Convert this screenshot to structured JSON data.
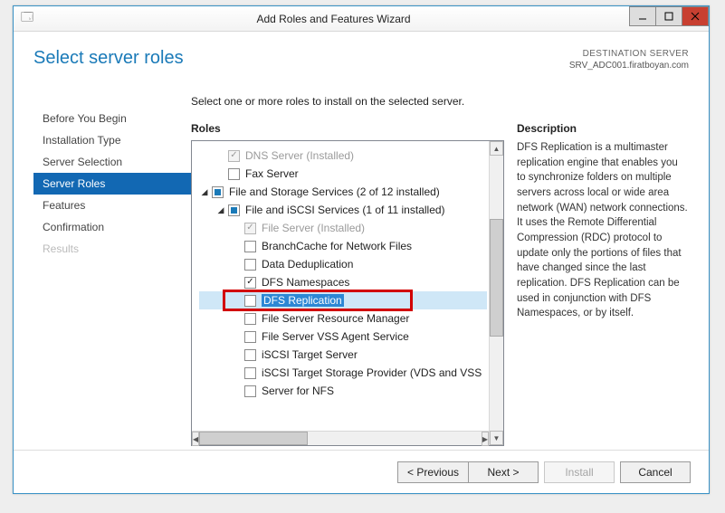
{
  "window": {
    "title": "Add Roles and Features Wizard"
  },
  "header": {
    "title": "Select server roles",
    "destination_label": "DESTINATION SERVER",
    "destination_server": "SRV_ADC001.firatboyan.com"
  },
  "nav": {
    "items": [
      "Before You Begin",
      "Installation Type",
      "Server Selection",
      "Server Roles",
      "Features",
      "Confirmation",
      "Results"
    ],
    "active_index": 3
  },
  "main": {
    "instructions": "Select one or more roles to install on the selected server.",
    "roles_label": "Roles",
    "description_label": "Description",
    "description_text": "DFS Replication is a multimaster replication engine that enables you to synchronize folders on multiple servers across local or wide area network (WAN) network connections. It uses the Remote Differential Compression (RDC) protocol to update only the portions of files that have changed since the last replication. DFS Replication can be used in conjunction with DFS Namespaces, or by itself.",
    "roles": [
      {
        "indent": 1,
        "twisty": "",
        "check": "chk",
        "disabled": true,
        "label": "DNS Server (Installed)",
        "selected": false
      },
      {
        "indent": 1,
        "twisty": "",
        "check": "off",
        "disabled": false,
        "label": "Fax Server",
        "selected": false
      },
      {
        "indent": 0,
        "twisty": "open",
        "check": "tri",
        "disabled": false,
        "label": "File and Storage Services (2 of 12 installed)",
        "selected": false
      },
      {
        "indent": 1,
        "twisty": "open",
        "check": "tri",
        "disabled": false,
        "label": "File and iSCSI Services (1 of 11 installed)",
        "selected": false
      },
      {
        "indent": 2,
        "twisty": "",
        "check": "chk",
        "disabled": true,
        "label": "File Server (Installed)",
        "selected": false
      },
      {
        "indent": 2,
        "twisty": "",
        "check": "off",
        "disabled": false,
        "label": "BranchCache for Network Files",
        "selected": false
      },
      {
        "indent": 2,
        "twisty": "",
        "check": "off",
        "disabled": false,
        "label": "Data Deduplication",
        "selected": false
      },
      {
        "indent": 2,
        "twisty": "",
        "check": "chk",
        "disabled": false,
        "label": "DFS Namespaces",
        "selected": false
      },
      {
        "indent": 2,
        "twisty": "",
        "check": "off",
        "disabled": false,
        "label": "DFS Replication",
        "selected": true
      },
      {
        "indent": 2,
        "twisty": "",
        "check": "off",
        "disabled": false,
        "label": "File Server Resource Manager",
        "selected": false
      },
      {
        "indent": 2,
        "twisty": "",
        "check": "off",
        "disabled": false,
        "label": "File Server VSS Agent Service",
        "selected": false
      },
      {
        "indent": 2,
        "twisty": "",
        "check": "off",
        "disabled": false,
        "label": "iSCSI Target Server",
        "selected": false
      },
      {
        "indent": 2,
        "twisty": "",
        "check": "off",
        "disabled": false,
        "label": "iSCSI Target Storage Provider (VDS and VSS",
        "selected": false
      },
      {
        "indent": 2,
        "twisty": "",
        "check": "off",
        "disabled": false,
        "label": "Server for NFS",
        "selected": false
      }
    ]
  },
  "footer": {
    "previous": "< Previous",
    "next": "Next >",
    "install": "Install",
    "cancel": "Cancel"
  }
}
